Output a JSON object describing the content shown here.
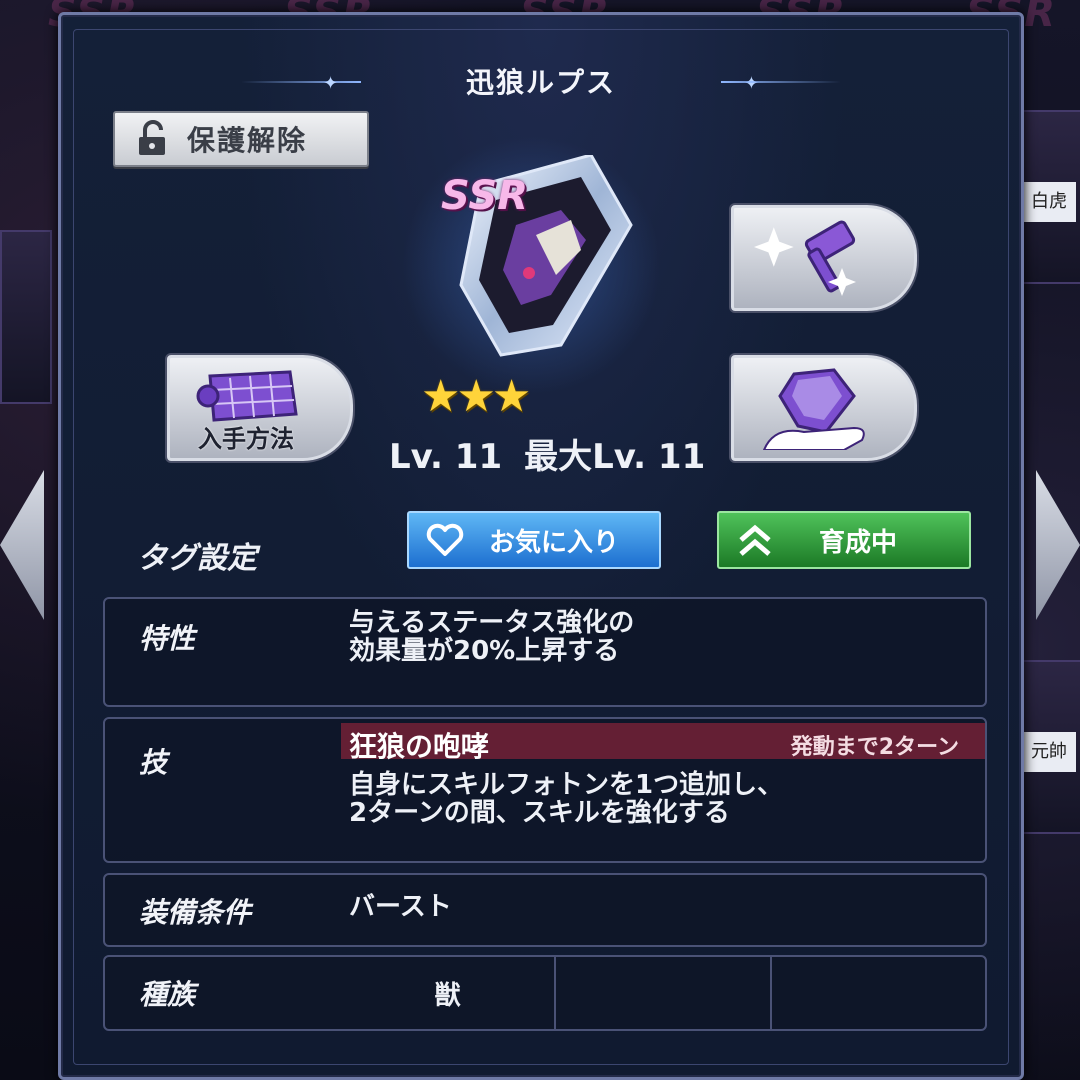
{
  "background": {
    "ssr_marks": [
      "SSR",
      "SSR",
      "SSR",
      "SSR",
      "SSR"
    ],
    "side_card_captions": [
      "白虎",
      "元帥"
    ]
  },
  "modal": {
    "title": "迅狼ルプス",
    "lock_button_label": "保護解除"
  },
  "item": {
    "rarity": "SSR",
    "stars": "★★★",
    "star_count": 3,
    "level": "Lv. 11",
    "max_level": "最大Lv. 11"
  },
  "actions": {
    "acquire_label": "入手方法",
    "forge_icon": "hammer-sparkle-icon",
    "gem_icon": "gem-hand-icon"
  },
  "tags": {
    "label": "タグ設定",
    "favorite_label": "お気に入り",
    "training_label": "育成中"
  },
  "info": {
    "trait_label": "特性",
    "trait_lines": [
      "与えるステータス強化の",
      "効果量が20%上昇する"
    ],
    "skill_label": "技",
    "skill_name": "狂狼の咆哮",
    "skill_turns": "発動まで2ターン",
    "skill_lines": [
      "自身にスキルフォトンを1つ追加し、",
      "2ターンの間、スキルを強化する"
    ],
    "equip_label": "装備条件",
    "equip_value": "バースト",
    "race_label": "種族",
    "race_values": [
      "獣",
      "",
      ""
    ]
  },
  "colors": {
    "favorite": "#1d6fd0",
    "training": "#1c7a26",
    "skill_bar": "#641f34",
    "rarity": "#f7b8e9"
  }
}
